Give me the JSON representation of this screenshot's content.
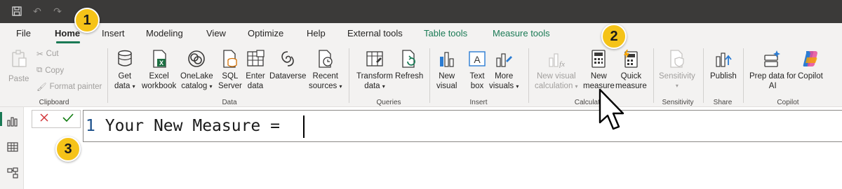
{
  "tabs": [
    "File",
    "Home",
    "Insert",
    "Modeling",
    "View",
    "Optimize",
    "Help",
    "External tools",
    "Table tools",
    "Measure tools"
  ],
  "active_tab": "Home",
  "clipboard": {
    "paste": "Paste",
    "cut": "Cut",
    "copy": "Copy",
    "format_painter": "Format painter",
    "group": "Clipboard"
  },
  "data": {
    "get_data": [
      "Get",
      "data"
    ],
    "excel": [
      "Excel",
      "workbook"
    ],
    "onelake": [
      "OneLake",
      "catalog"
    ],
    "sql": [
      "SQL",
      "Server"
    ],
    "enter": [
      "Enter",
      "data"
    ],
    "dataverse": [
      "Dataverse"
    ],
    "recent": [
      "Recent",
      "sources"
    ],
    "group": "Data"
  },
  "queries": {
    "transform": [
      "Transform",
      "data"
    ],
    "refresh": [
      "Refresh"
    ],
    "group": "Queries"
  },
  "insert": {
    "new_visual": [
      "New",
      "visual"
    ],
    "text_box": [
      "Text",
      "box"
    ],
    "more_visuals": [
      "More",
      "visuals"
    ],
    "group": "Insert"
  },
  "calculations": {
    "new_visual_calc": [
      "New visual",
      "calculation"
    ],
    "new_measure": [
      "New",
      "measure"
    ],
    "quick_measure": [
      "Quick",
      "measure"
    ],
    "group": "Calculations"
  },
  "sensitivity": {
    "label": "Sensitivity",
    "group": "Sensitivity"
  },
  "share": {
    "publish": "Publish",
    "group": "Share"
  },
  "copilot": {
    "prep": [
      "Prep data for",
      "AI"
    ],
    "copilot": "Copilot",
    "group": "Copilot"
  },
  "editor": {
    "line_number": "1",
    "text": "Your New Measure = "
  },
  "badges": [
    "1",
    "2",
    "3"
  ],
  "colors": {
    "accent": "#1a7a55",
    "badge": "#f5c318",
    "titlebar": "#3b3a39"
  }
}
